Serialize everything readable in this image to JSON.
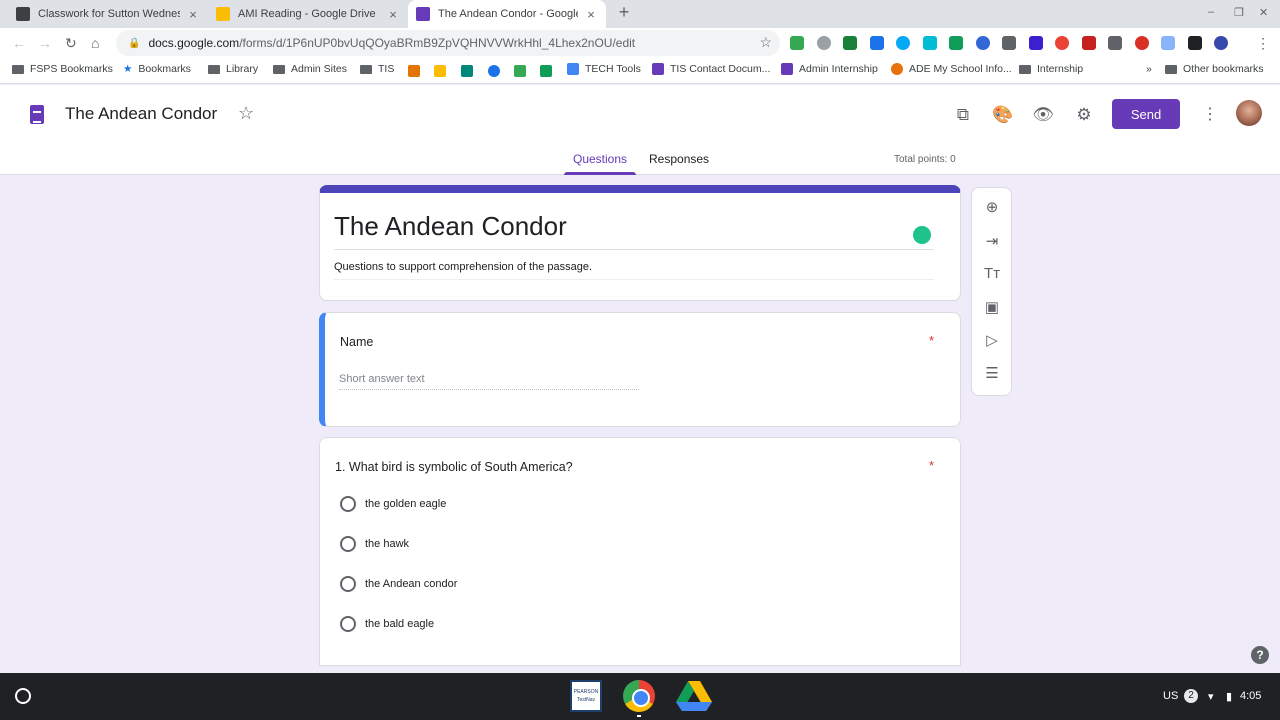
{
  "browser": {
    "tabs": [
      {
        "title": "Classwork for Sutton Wednesday",
        "favicon_color": "#3c4043",
        "active": false
      },
      {
        "title": "AMI Reading - Google Drive",
        "favicon_color": "#fbbc04",
        "active": false
      },
      {
        "title": "The Andean Condor - Google Forms",
        "favicon_color": "#673ab7",
        "active": true
      }
    ],
    "new_tab": "+",
    "close_glyph": "×",
    "window_controls": [
      "–",
      "❐",
      "✕"
    ],
    "nav": {
      "back": "←",
      "forward": "→",
      "reload": "↻",
      "home": "⌂"
    },
    "url": {
      "host": "docs.google.com",
      "path": "/forms/d/1P6nUP0bvUqQOyaBRmB9ZpVQHNVVWrkHhl_4Lhex2nOU/edit",
      "lock": "🔒",
      "star": "☆"
    },
    "extension_colors": [
      "#34a853",
      "#9aa0a6",
      "#188038",
      "#1a73e8",
      "#03a9f4",
      "#00bcd4",
      "#0f9d58",
      "#3367d6",
      "#5f6368",
      "#3c1fd1",
      "#ea4335",
      "#c5221f",
      "#5f6368",
      "#d93025",
      "#8ab4f8",
      "#202124",
      "#3949ab"
    ],
    "menu_glyph": "⋮"
  },
  "bookmarks": {
    "items": [
      {
        "label": "FSPS Bookmarks",
        "kind": "folder"
      },
      {
        "label": "Bookmarks",
        "kind": "star"
      },
      {
        "label": "Library",
        "kind": "folder"
      },
      {
        "label": "Admin Sites",
        "kind": "folder"
      },
      {
        "label": "TIS",
        "kind": "folder"
      },
      {
        "label": "TECH Tools",
        "kind": "doc"
      },
      {
        "label": "TIS Contact Docum...",
        "kind": "form"
      },
      {
        "label": "Admin Internship",
        "kind": "form"
      },
      {
        "label": "ADE My School Info...",
        "kind": "pin"
      },
      {
        "label": "Internship",
        "kind": "folder"
      }
    ],
    "overflow": "»",
    "other": "Other bookmarks"
  },
  "app": {
    "title": "The Andean Condor",
    "star": "☆",
    "send_label": "Send",
    "kebab": "⋮",
    "toolbar_icons": [
      "puzzle-icon",
      "palette-icon",
      "eye-icon",
      "settings-icon"
    ],
    "toolbar_glyphs": [
      "⧉",
      "🎨",
      "👁",
      "⚙"
    ],
    "tabs": [
      {
        "label": "Questions",
        "active": true
      },
      {
        "label": "Responses",
        "active": false
      }
    ],
    "total_points": "Total points: 0",
    "accent": "#673ab7"
  },
  "form": {
    "title": "The Andean Condor",
    "description": "Questions to support comprehension of the passage.",
    "questions": [
      {
        "title": "Name",
        "required": "*",
        "placeholder": "Short answer text"
      },
      {
        "title": "1. What bird is symbolic of South America?",
        "required": "*",
        "options": [
          "the golden eagle",
          "the hawk",
          "the Andean condor",
          "the bald eagle"
        ]
      }
    ]
  },
  "side_tools": {
    "glyphs": [
      "⊕",
      "⇥",
      "Tт",
      "▣",
      "▷",
      "☰"
    ]
  },
  "help": "?",
  "shelf": {
    "pearson_label": "PEARSON TestNav",
    "status": {
      "keyboard": "US",
      "notifications": "2",
      "wifi": "▾",
      "battery": "▮",
      "time": "4:05"
    }
  }
}
